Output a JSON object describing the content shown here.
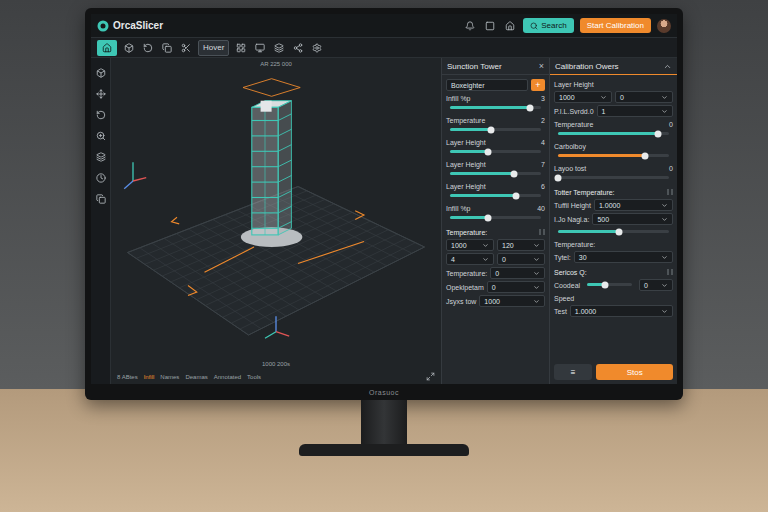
{
  "window": {
    "title": "OrcaSlicer"
  },
  "topbar": {
    "search": "Search",
    "calibrate": "Start Calibration"
  },
  "toolbar": {
    "home_selected": true,
    "tab": {
      "label": "Hover",
      "selected": true
    }
  },
  "viewport": {
    "top_label": "AR 225 000",
    "bottom_label": "1000 200s"
  },
  "status_bar": [
    {
      "label": "8 ABtes",
      "selected": false
    },
    {
      "label": "Infill",
      "selected": true
    },
    {
      "label": "Names",
      "selected": false
    },
    {
      "label": "Deamas",
      "selected": false
    },
    {
      "label": "Annotated",
      "selected": false
    },
    {
      "label": "Tools",
      "selected": false
    }
  ],
  "tower_panel": {
    "title": "Sunction Tower",
    "close": "×",
    "input": "Boxeighter",
    "add": "+",
    "sliders": [
      {
        "label": "Infill %p",
        "value": "3",
        "level": 0.88
      },
      {
        "label": "Temperature",
        "value": "2",
        "level": 0.45
      },
      {
        "label": "Layer Height",
        "value": "4",
        "level": 0.42
      },
      {
        "label": "Layer Height",
        "value": "7",
        "level": 0.7
      },
      {
        "label": "Layer Height",
        "value": "6",
        "level": 0.72
      },
      {
        "label": "Infill %p",
        "value": "40",
        "level": 0.42
      }
    ],
    "section": {
      "title": "Temperature:",
      "rows": [
        {
          "kind": "pair",
          "a": "1000",
          "b": "120"
        },
        {
          "kind": "pair",
          "a": "4",
          "b": "0"
        },
        {
          "kind": "field",
          "label": "Temperature:",
          "value": "0"
        },
        {
          "kind": "field",
          "label": "Opeklpetam",
          "value": "0"
        },
        {
          "kind": "field",
          "label": "Jsyxs tow",
          "value": "1000"
        }
      ]
    }
  },
  "calibration_panel": {
    "title": "Calibration Owers",
    "items": [
      {
        "kind": "label",
        "label": "Layer Height"
      },
      {
        "kind": "pair",
        "a": "1000",
        "b": "0"
      },
      {
        "kind": "field",
        "label": "P.I.L.Svrdd.0",
        "value": "1"
      },
      {
        "kind": "slider",
        "label": "Temperature",
        "value": "0",
        "level": 0.9,
        "color": "#3ec7b5"
      },
      {
        "kind": "slider",
        "label": "Carbolboy",
        "level": 0.78,
        "color": "#f08a2c"
      },
      {
        "kind": "slider",
        "label": "Layoo tost",
        "value": "0",
        "level": 0.0,
        "color": "#3ec7b5"
      },
      {
        "kind": "heading",
        "label": "Totter Temperature:"
      },
      {
        "kind": "field",
        "label": "Tuffil Height",
        "value": "1.0000"
      },
      {
        "kind": "field",
        "label": "I.Jo Nagl.a:",
        "value": "500"
      },
      {
        "kind": "slider",
        "level": 0.55,
        "color": "#3ec7b5"
      },
      {
        "kind": "label",
        "label": "Temperature:"
      },
      {
        "kind": "field",
        "label": "Tytel:",
        "value": "30"
      },
      {
        "kind": "heading",
        "label": "Sericos Q:"
      },
      {
        "kind": "slidefield",
        "label": "Coodeal",
        "value": "0",
        "level": 0.4,
        "color": "#3ec7b5"
      },
      {
        "kind": "label",
        "label": "Speed"
      },
      {
        "kind": "field",
        "label": "Test",
        "value": "1.0000"
      }
    ],
    "buttons": [
      {
        "label": "≡",
        "primary": false
      },
      {
        "label": "Stos",
        "primary": true
      }
    ]
  },
  "bezel_brand": "Orasuoc"
}
